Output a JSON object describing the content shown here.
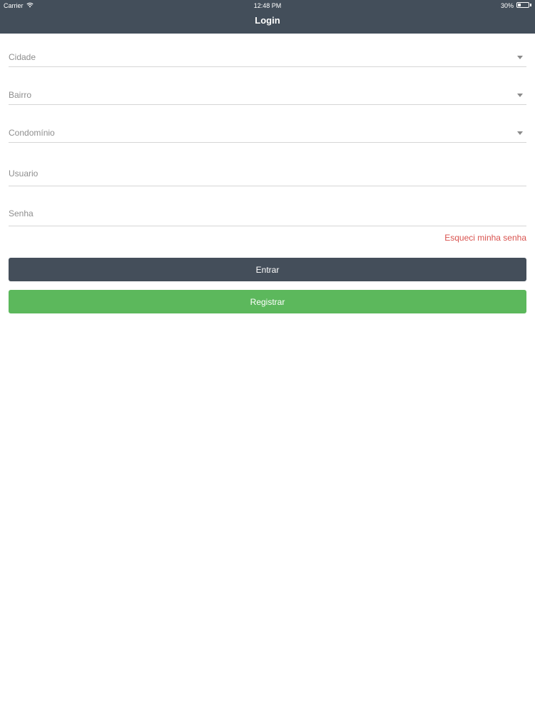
{
  "status_bar": {
    "carrier": "Carrier",
    "time": "12:48 PM",
    "battery": "30%"
  },
  "header": {
    "title": "Login"
  },
  "form": {
    "cidade": {
      "placeholder": "Cidade",
      "icon": "chevron-down-icon"
    },
    "bairro": {
      "placeholder": "Bairro",
      "icon": "chevron-down-icon"
    },
    "condominio": {
      "placeholder": "Condomínio",
      "icon": "chevron-down-icon"
    },
    "usuario": {
      "placeholder": "Usuario"
    },
    "senha": {
      "placeholder": "Senha"
    },
    "forgot_password": "Esqueci minha senha"
  },
  "buttons": {
    "entrar": "Entrar",
    "registrar": "Registrar"
  },
  "colors": {
    "header_bg": "#434e5a",
    "entrar_bg": "#444e5a",
    "registrar_bg": "#5cb85c",
    "link": "#d9534f"
  },
  "battery_level": 0.3
}
